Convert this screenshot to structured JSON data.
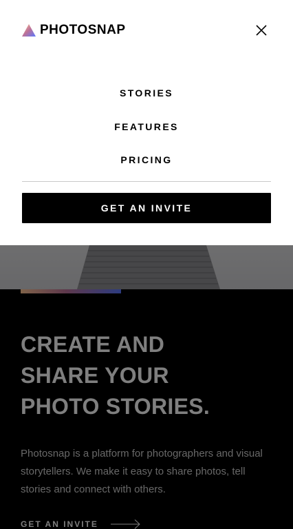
{
  "header": {
    "brand": "PHOTOSNAP",
    "logo_icon": "photosnap-triangle-logo",
    "close_icon": "close-icon"
  },
  "menu": {
    "items": [
      {
        "label": "STORIES"
      },
      {
        "label": "FEATURES"
      },
      {
        "label": "PRICING"
      }
    ],
    "cta_label": "GET AN INVITE"
  },
  "hero": {
    "title_lines": [
      "CREATE AND",
      "SHARE YOUR",
      "PHOTO STORIES."
    ],
    "description": "Photosnap is a platform for photographers and visual storytellers. We make it easy to share photos, tell stories and connect with others.",
    "link_label": "GET AN INVITE",
    "link_icon": "arrow-right-icon"
  },
  "colors": {
    "accent_start": "#ffc593",
    "accent_mid": "#bc7198",
    "accent_end": "#5a77ff",
    "dark": "#000000",
    "light": "#ffffff"
  }
}
